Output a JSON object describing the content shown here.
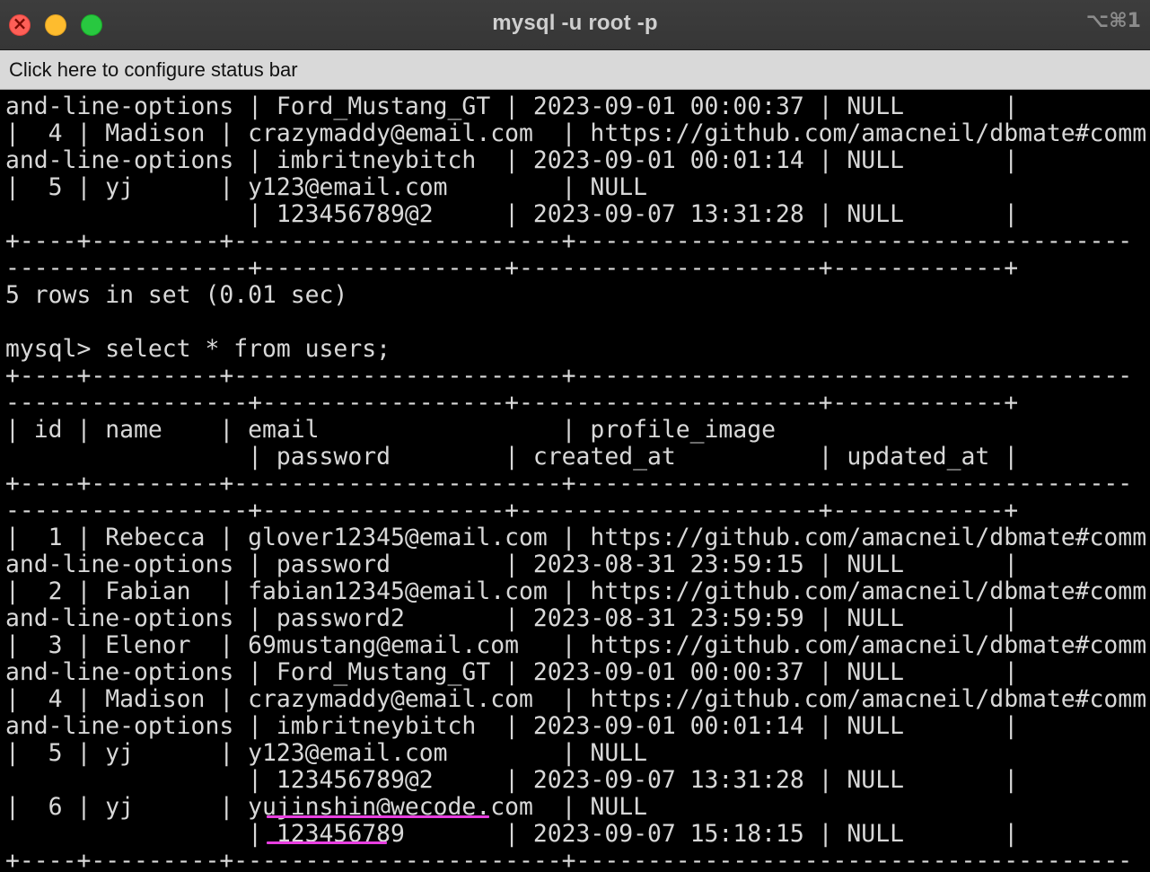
{
  "window": {
    "title": "mysql -u root -p",
    "shortcut": "⌥⌘1",
    "status_bar_label": "Click here to configure status bar"
  },
  "terminal": {
    "lines": [
      "and-line-options | Ford_Mustang_GT | 2023-09-01 00:00:37 | NULL       |",
      "|  4 | Madison | crazymaddy@email.com  | https://github.com/amacneil/dbmate#comm",
      "and-line-options | imbritneybitch  | 2023-09-01 00:01:14 | NULL       |",
      "|  5 | yj      | y123@email.com        | NULL",
      "                 | 123456789@2     | 2023-09-07 13:31:28 | NULL       |",
      "+----+---------+-----------------------+---------------------------------------",
      "-----------------+-----------------+---------------------+------------+",
      "5 rows in set (0.01 sec)",
      "",
      "mysql> select * from users;",
      "+----+---------+-----------------------+---------------------------------------",
      "-----------------+-----------------+---------------------+------------+",
      "| id | name    | email                 | profile_image",
      "                 | password        | created_at          | updated_at |",
      "+----+---------+-----------------------+---------------------------------------",
      "-----------------+-----------------+---------------------+------------+",
      "|  1 | Rebecca | glover12345@email.com | https://github.com/amacneil/dbmate#comm",
      "and-line-options | password        | 2023-08-31 23:59:15 | NULL       |",
      "|  2 | Fabian  | fabian12345@email.com | https://github.com/amacneil/dbmate#comm",
      "and-line-options | password2       | 2023-08-31 23:59:59 | NULL       |",
      "|  3 | Elenor  | 69mustang@email.com   | https://github.com/amacneil/dbmate#comm",
      "and-line-options | Ford_Mustang_GT | 2023-09-01 00:00:37 | NULL       |",
      "|  4 | Madison | crazymaddy@email.com  | https://github.com/amacneil/dbmate#comm",
      "and-line-options | imbritneybitch  | 2023-09-01 00:01:14 | NULL       |",
      "|  5 | yj      | y123@email.com        | NULL",
      "                 | 123456789@2     | 2023-09-07 13:31:28 | NULL       |",
      "|  6 | yj      | yujinshin@wecode.com  | NULL",
      "                 | 123456789       | 2023-09-07 15:18:15 | NULL       |",
      "+----+---------+-----------------------+---------------------------------------"
    ]
  },
  "annotations": {
    "underline_color": "#e83ee0"
  },
  "colors": {
    "terminal_bg": "#000000",
    "terminal_fg": "#d8d8d8",
    "titlebar_bg": "#3a3a3a",
    "status_bar_bg": "#d9d9d9"
  }
}
